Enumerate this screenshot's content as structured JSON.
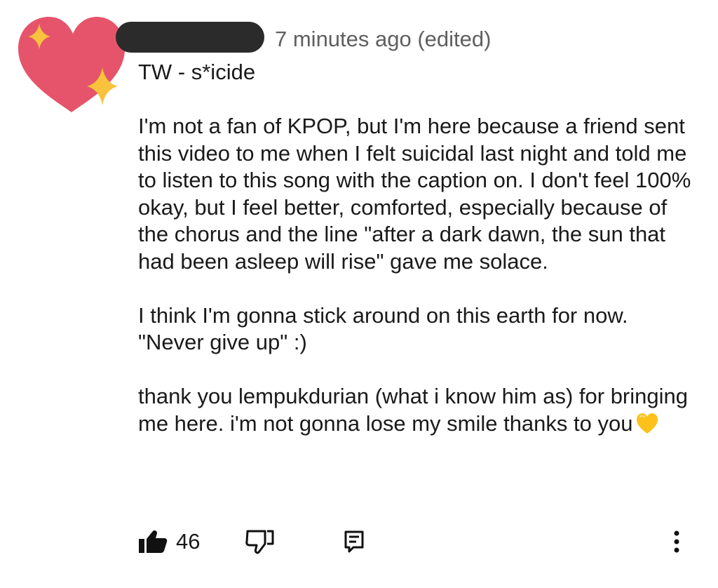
{
  "comment": {
    "timestamp": "7 minutes ago (edited)",
    "paragraphs": [
      "TW - s*icide",
      "I'm not a fan of KPOP, but I'm here because a friend sent this video to me when I felt suicidal last night and told me to listen to this song with the caption on. I don't feel 100% okay, but I feel better, comforted, especially because of the chorus and the line \"after a dark dawn, the sun that had been asleep will rise\" gave me solace.",
      "I think I'm gonna stick around on this earth for now. \"Never give up\" :)",
      "thank you lempukdurian (what i know him as) for bringing me here. i'm not gonna lose my smile thanks to you"
    ],
    "avatar": {
      "icon": "sparkling-heart-icon",
      "heart_color": "#e5546b",
      "sparkle_color": "#f9c23c"
    },
    "trailing_emoji": {
      "icon": "yellow-heart-icon",
      "color": "#fcc21b"
    }
  },
  "actions": {
    "like_icon": "thumbs-up-icon",
    "like_count": "46",
    "dislike_icon": "thumbs-down-icon",
    "reply_icon": "reply-icon",
    "more_icon": "more-vertical-icon"
  }
}
